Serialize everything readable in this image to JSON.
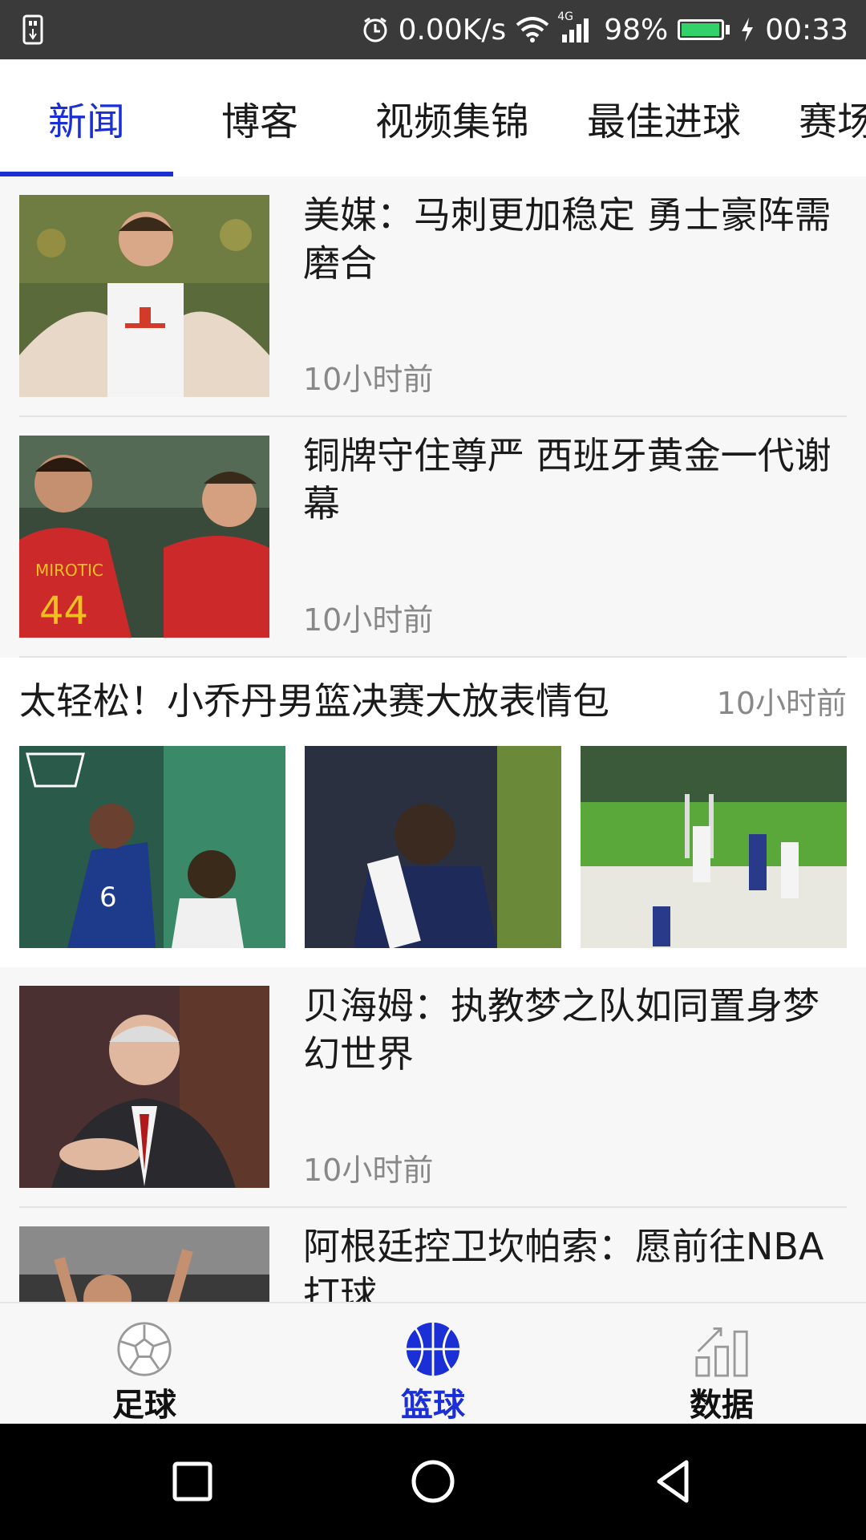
{
  "status_bar": {
    "speed": "0.00K/s",
    "network": "4G",
    "battery_percent": "98%",
    "battery_level": 0.98,
    "time": "00:33",
    "icons": [
      "usb-icon",
      "alarm-icon",
      "wifi-icon",
      "signal-icon",
      "battery-icon",
      "charging-icon"
    ]
  },
  "tabs": [
    {
      "label": "新闻",
      "active": true
    },
    {
      "label": "博客",
      "active": false
    },
    {
      "label": "视频集锦",
      "active": false
    },
    {
      "label": "最佳进球",
      "active": false
    },
    {
      "label": "赛场",
      "active": false
    }
  ],
  "feed": {
    "items": [
      {
        "title": "美媒：马刺更加稳定 勇士豪阵需磨合",
        "time": "10小时前"
      },
      {
        "title": "铜牌守住尊严 西班牙黄金一代谢幕",
        "time": "10小时前"
      },
      {
        "title": "贝海姆：执教梦之队如同置身梦幻世界",
        "time": "10小时前"
      },
      {
        "title": "阿根廷控卫坎帕索：愿前往NBA打球",
        "time": ""
      }
    ],
    "gallery": {
      "title": "太轻松！小乔丹男篮决赛大放表情包",
      "time": "10小时前"
    }
  },
  "bottom_nav": [
    {
      "label": "足球",
      "icon": "soccer-ball-icon",
      "active": false
    },
    {
      "label": "篮球",
      "icon": "basketball-icon",
      "active": true
    },
    {
      "label": "数据",
      "icon": "bar-chart-icon",
      "active": false
    }
  ],
  "colors": {
    "accent": "#1a2fd6",
    "status_bar": "#3a3a3a",
    "battery": "#33d16a"
  }
}
